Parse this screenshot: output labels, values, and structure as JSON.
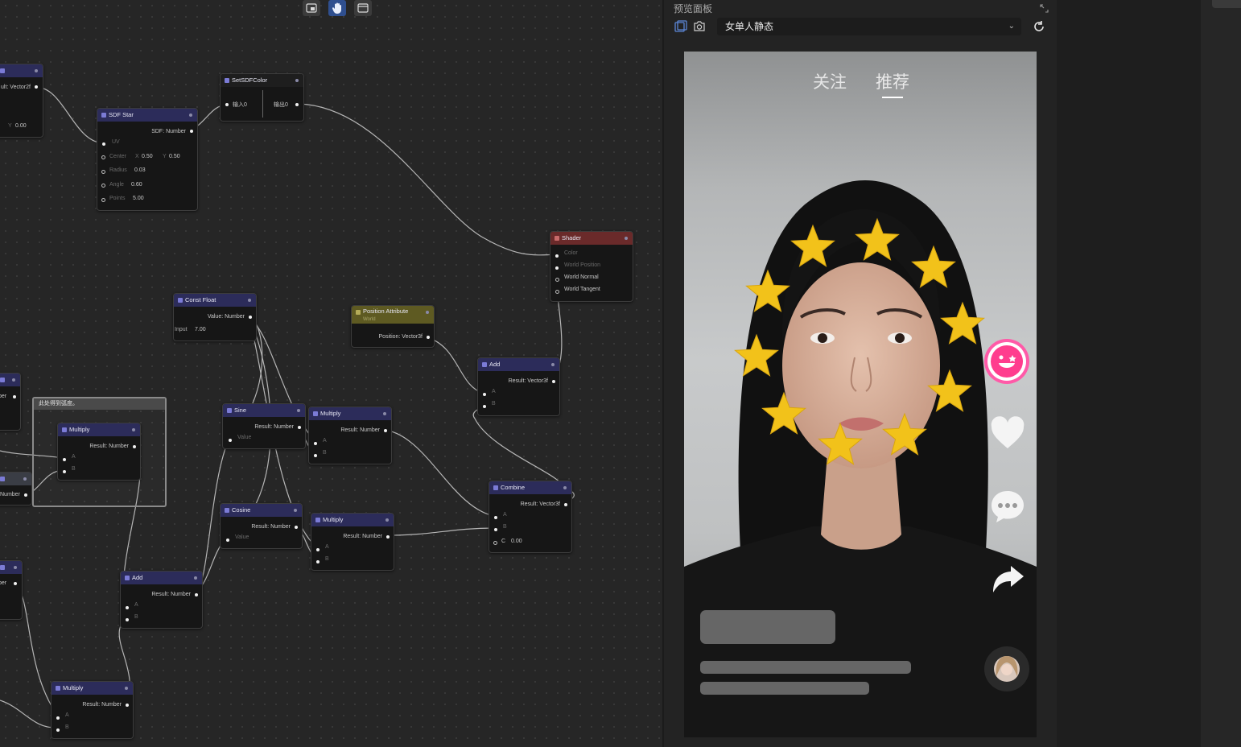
{
  "toolbar": {
    "tools": [
      "screen-icon",
      "hand-icon",
      "window-icon"
    ],
    "active": "hand-icon"
  },
  "nodes": {
    "partial_top": {
      "output": "ult: Vector2f",
      "y_label": "Y",
      "y_value": "0.00"
    },
    "sdf_star": {
      "title": "SDF Star",
      "output": "SDF: Number",
      "uv": "UV",
      "center_label": "Center",
      "center_x_label": "X",
      "center_x": "0.50",
      "center_y_label": "Y",
      "center_y": "0.50",
      "radius_label": "Radius",
      "radius": "0.03",
      "angle_label": "Angle",
      "angle": "0.60",
      "points_label": "Points",
      "points": "5.00"
    },
    "set_sdf_color": {
      "title": "SetSDFColor",
      "input": "输入0",
      "output": "输出0"
    },
    "shader": {
      "title": "Shader",
      "color": "Color",
      "world_position": "World Position",
      "world_normal": "World Normal",
      "world_tangent": "World Tangent"
    },
    "const_float": {
      "title": "Const Float",
      "output": "Value: Number",
      "input_label": "Input",
      "input_value": "7.00"
    },
    "position_attribute": {
      "title": "Position Attribute",
      "subtitle": "World",
      "output": "Position: Vector3f"
    },
    "add_vec": {
      "title": "Add",
      "output": "Result: Vector3f",
      "a": "A",
      "b": "B"
    },
    "sine": {
      "title": "Sine",
      "output": "Result: Number",
      "value": "Value"
    },
    "multiply_1": {
      "title": "Multiply",
      "output": "Result: Number",
      "a": "A",
      "b": "B"
    },
    "cosine": {
      "title": "Cosine",
      "output": "Result: Number",
      "value": "Value"
    },
    "multiply_2": {
      "title": "Multiply",
      "output": "Result: Number",
      "a": "A",
      "b": "B"
    },
    "combine": {
      "title": "Combine",
      "output": "Result: Vector3f",
      "a": "A",
      "b": "B",
      "c_label": "C",
      "c_value": "0.00"
    },
    "group_multiply": {
      "title": "Multiply",
      "output": "Result: Number",
      "a": "A",
      "b": "B"
    },
    "add_num": {
      "title": "Add",
      "output": "Result: Number",
      "a": "A",
      "b": "B"
    },
    "multiply_3": {
      "title": "Multiply",
      "output": "Result: Number",
      "a": "A",
      "b": "B"
    },
    "partial_left_1": {
      "output": "ber"
    },
    "partial_left_2": {
      "output": "Number"
    },
    "partial_left_3": {
      "output": "ber"
    }
  },
  "group": {
    "label": "此处得到弧度。"
  },
  "panel": {
    "title": "预览面板",
    "preset": "女单人静态",
    "phone": {
      "tab_follow": "关注",
      "tab_recommend": "推荐",
      "active_tab": "推荐"
    },
    "side_icons": [
      "effect-face-icon",
      "heart-icon",
      "comment-icon",
      "share-icon",
      "avatar"
    ]
  },
  "colors": {
    "wire": "#cfcfcf",
    "star": "#f2c21a",
    "node_header": "#2c2c5a",
    "shader_header": "#6a2a2a",
    "position_header": "#5e5a22"
  }
}
